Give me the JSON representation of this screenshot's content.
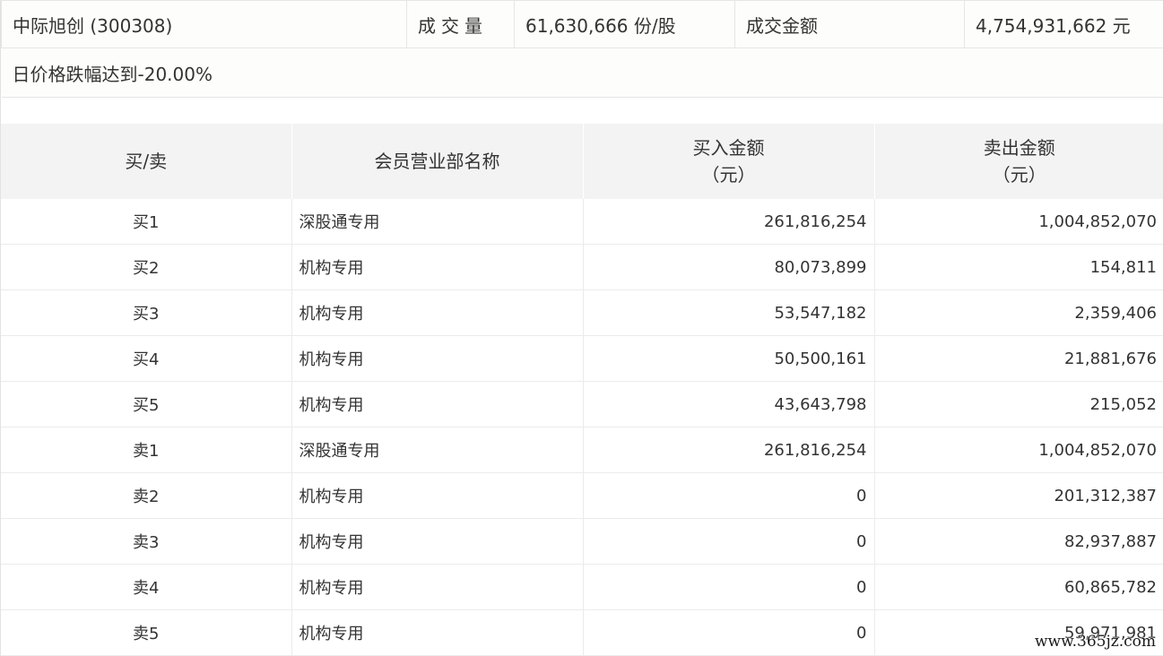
{
  "summary": {
    "stock": "中际旭创 (300308)",
    "volume_label": "成交量",
    "volume_value": "61,630,666 份/股",
    "amount_label": "成交金额",
    "amount_value": "4,754,931,662 元",
    "reason": "日价格跌幅达到-20.00%"
  },
  "table": {
    "headers": {
      "side": "买/卖",
      "member": "会员营业部名称",
      "buy_line1": "买入金额",
      "buy_line2": "（元）",
      "sell_line1": "卖出金额",
      "sell_line2": "（元）"
    },
    "rows": [
      {
        "side": "买1",
        "member": "深股通专用",
        "buy": "261,816,254",
        "sell": "1,004,852,070"
      },
      {
        "side": "买2",
        "member": "机构专用",
        "buy": "80,073,899",
        "sell": "154,811"
      },
      {
        "side": "买3",
        "member": "机构专用",
        "buy": "53,547,182",
        "sell": "2,359,406"
      },
      {
        "side": "买4",
        "member": "机构专用",
        "buy": "50,500,161",
        "sell": "21,881,676"
      },
      {
        "side": "买5",
        "member": "机构专用",
        "buy": "43,643,798",
        "sell": "215,052"
      },
      {
        "side": "卖1",
        "member": "深股通专用",
        "buy": "261,816,254",
        "sell": "1,004,852,070"
      },
      {
        "side": "卖2",
        "member": "机构专用",
        "buy": "0",
        "sell": "201,312,387"
      },
      {
        "side": "卖3",
        "member": "机构专用",
        "buy": "0",
        "sell": "82,937,887"
      },
      {
        "side": "卖4",
        "member": "机构专用",
        "buy": "0",
        "sell": "60,865,782"
      },
      {
        "side": "卖5",
        "member": "机构专用",
        "buy": "0",
        "sell": "59,971,981"
      }
    ]
  },
  "watermark": "www.365jz.com"
}
